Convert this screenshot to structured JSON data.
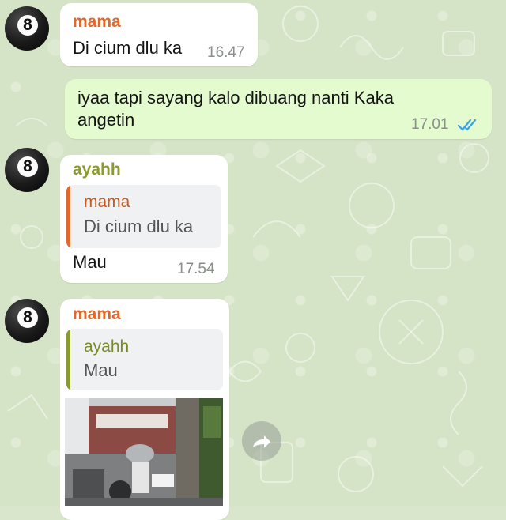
{
  "colors": {
    "mama_name": "#e0682a",
    "ayahh_name": "#8a9a2d",
    "read_ticks": "#3ba0e8",
    "outgoing_bubble": "#e3fbcf",
    "incoming_bubble": "#ffffff"
  },
  "messages": [
    {
      "sender": "mama",
      "text": "Di cium dlu ka",
      "time": "16.47",
      "avatar_icon": "8-ball-icon",
      "avatar_label": "8"
    },
    {
      "direction": "outgoing",
      "text_line1": "iyaa tapi sayang kalo dibuang nanti Kaka",
      "text_line2": "angetin",
      "time": "17.01",
      "status_icon": "double-check-read-icon"
    },
    {
      "sender": "ayahh",
      "avatar_label": "8",
      "quote": {
        "name": "mama",
        "text": "Di cium dlu ka"
      },
      "text": "Mau",
      "time": "17.54"
    },
    {
      "sender": "mama",
      "avatar_label": "8",
      "quote": {
        "name": "ayahh",
        "text": "Mau"
      },
      "media": "video-thumbnail",
      "forward_icon": "forward-arrow-icon"
    }
  ]
}
